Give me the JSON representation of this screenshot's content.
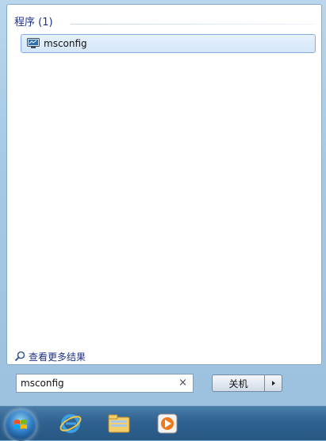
{
  "start_menu": {
    "group_header": "程序 (1)",
    "results": [
      {
        "label": "msconfig",
        "icon": "msconfig-icon"
      }
    ],
    "see_more_label": "查看更多结果",
    "search": {
      "value": "msconfig",
      "clear_glyph": "×"
    },
    "shutdown_label": "关机",
    "shutdown_arrow_glyph": "▸"
  },
  "taskbar": {
    "items": [
      {
        "icon": "start-orb-icon"
      },
      {
        "icon": "internet-explorer-icon"
      },
      {
        "icon": "file-explorer-icon"
      },
      {
        "icon": "media-player-icon"
      }
    ]
  },
  "colors": {
    "accent": "#1e3287",
    "selection_fill": "#d4e6f8",
    "selection_border": "#84acdd",
    "taskbar": "#2f6290"
  }
}
